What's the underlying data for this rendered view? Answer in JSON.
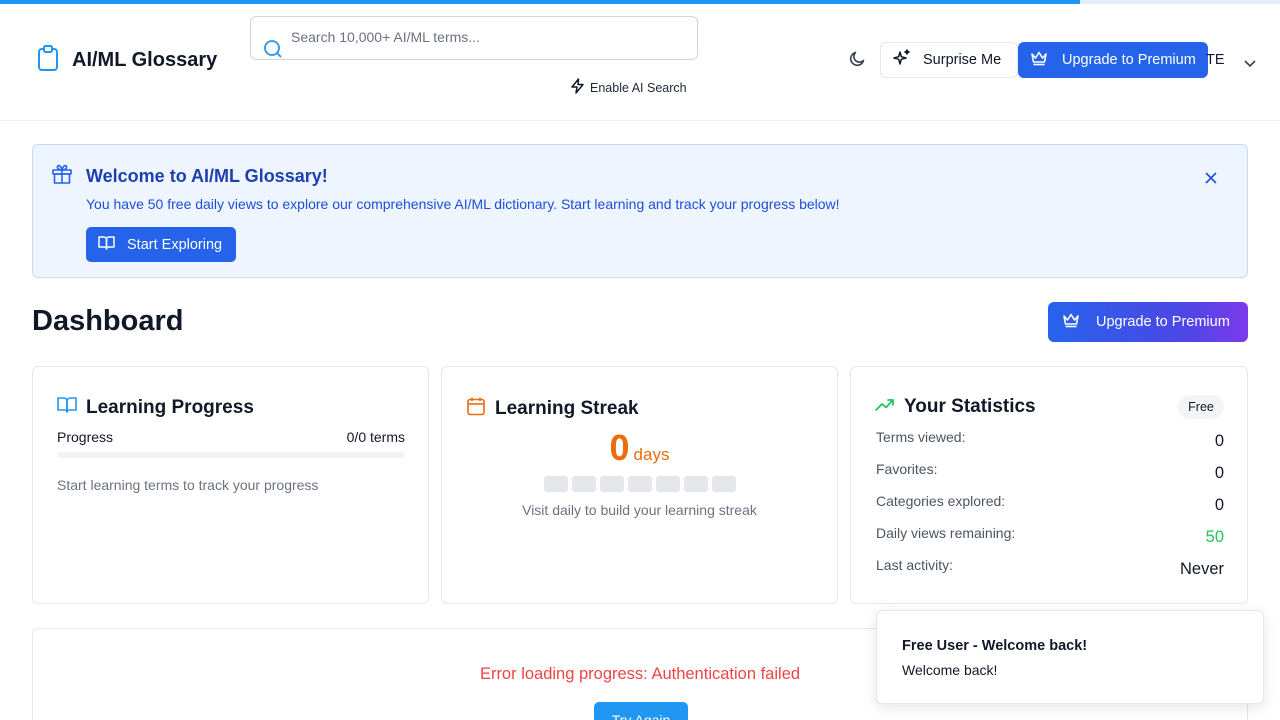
{
  "app": {
    "title": "AI/ML Glossary",
    "accent_color": "#2563eb"
  },
  "header": {
    "search_placeholder": "Search 10,000+ AI/ML terms...",
    "ai_search_label": "Enable AI Search",
    "surprise_label": "Surprise Me",
    "upgrade_label": "Upgrade to Premium",
    "user_initials": "TE",
    "icons": [
      "clipboard-icon",
      "search-icon",
      "lightning-icon",
      "moon-icon",
      "sparkles-icon",
      "crown-icon",
      "chevron-down-icon"
    ]
  },
  "welcome": {
    "title": "Welcome to AI/ML Glossary!",
    "description": "You have 50 free daily views to explore our comprehensive AI/ML dictionary. Start learning and track your progress below!",
    "button_label": "Start Exploring"
  },
  "dashboard": {
    "title": "Dashboard",
    "upgrade_label": "Upgrade to Premium"
  },
  "learning_progress": {
    "title": "Learning Progress",
    "progress_label": "Progress",
    "progress_value": "0/0 terms",
    "progress_fraction": 0,
    "note": "Start learning terms to track your progress"
  },
  "learning_streak": {
    "title": "Learning Streak",
    "days_count": "0",
    "days_label": "days",
    "note": "Visit daily to build your learning streak",
    "day_cells_active": [
      false,
      false,
      false,
      false,
      false,
      false,
      false
    ]
  },
  "statistics": {
    "title": "Your Statistics",
    "badge": "Free",
    "rows": [
      {
        "label": "Terms viewed:",
        "value": "0"
      },
      {
        "label": "Favorites:",
        "value": "0"
      },
      {
        "label": "Categories explored:",
        "value": "0"
      },
      {
        "label": "Daily views remaining:",
        "value": "50"
      },
      {
        "label": "Last activity:",
        "value": "Never"
      }
    ]
  },
  "error": {
    "message": "Error loading progress: Authentication failed",
    "retry_label": "Try Again"
  },
  "toast": {
    "title": "Free User - Welcome back!",
    "message": "Welcome back!"
  }
}
